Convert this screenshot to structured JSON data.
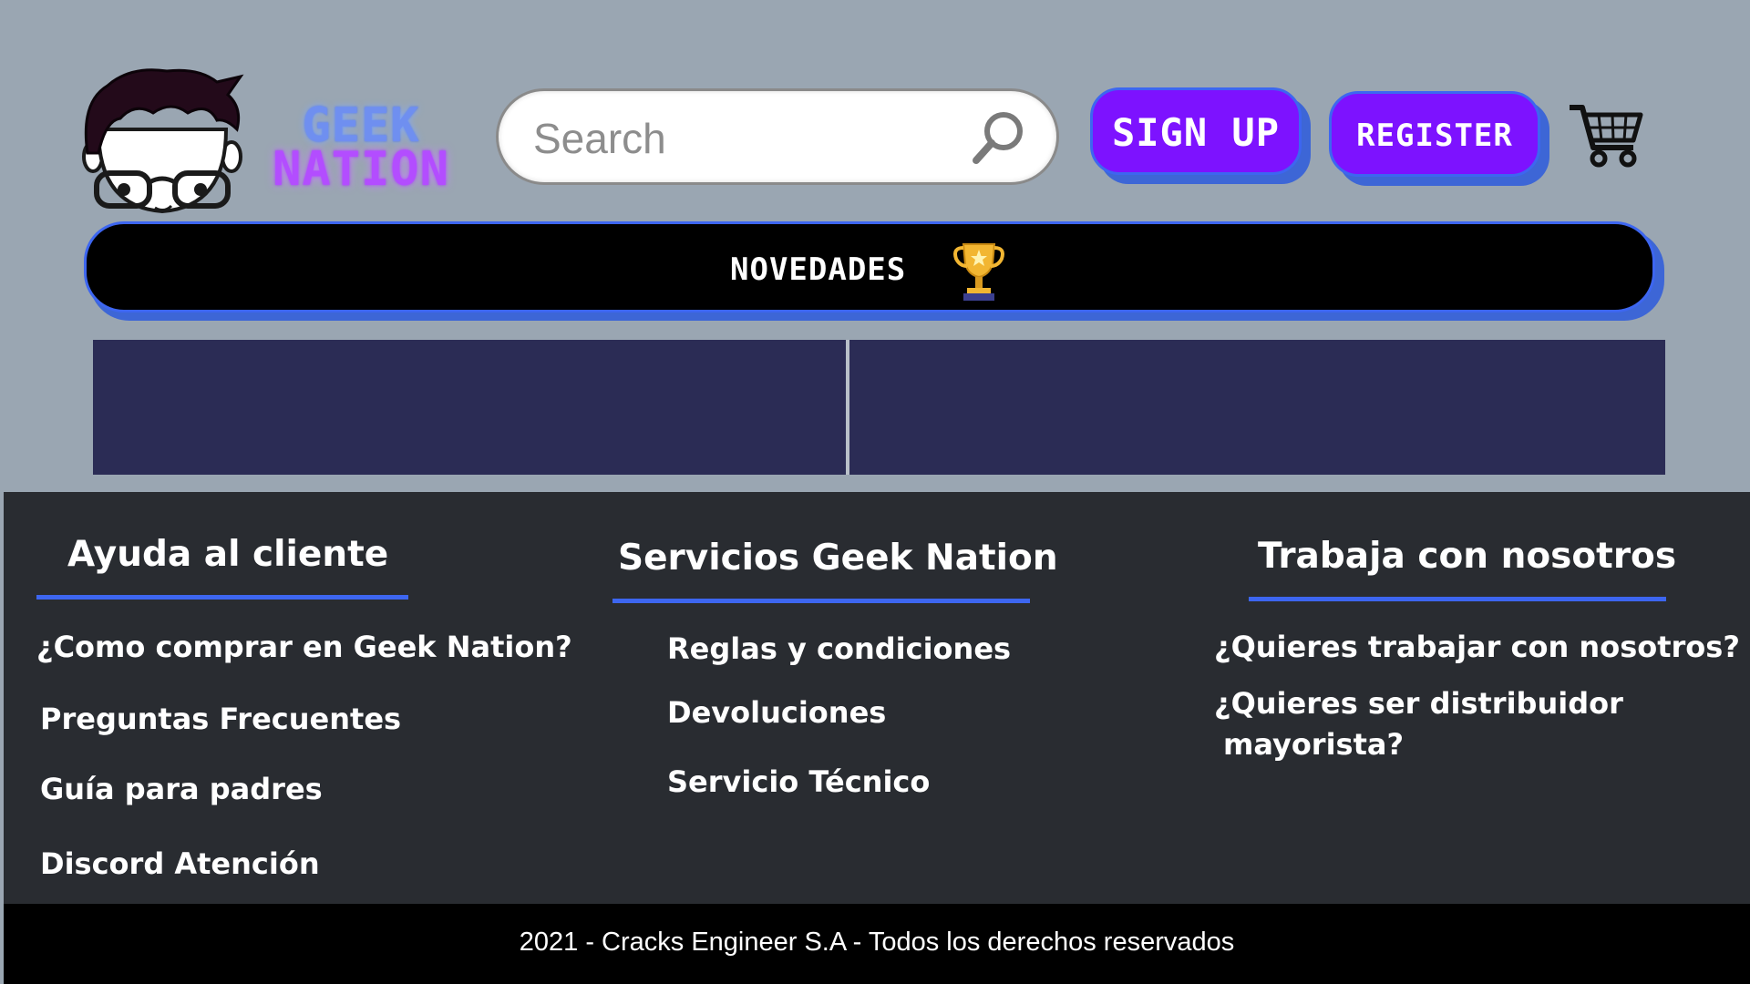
{
  "header": {
    "brand_line1": "GEEK",
    "brand_line2": "NATION",
    "search": {
      "placeholder": "Search"
    },
    "signup_label": "SIGN UP",
    "register_label": "REGISTER"
  },
  "nav": {
    "novedades_label": "NOVEDADES"
  },
  "footer": {
    "columns": [
      {
        "title": "Ayuda al cliente",
        "links": [
          "¿Como comprar en Geek Nation?",
          "Preguntas Frecuentes",
          "Guía para padres",
          "Discord Atención"
        ]
      },
      {
        "title": "Servicios Geek Nation",
        "links": [
          "Reglas y condiciones",
          "Devoluciones",
          "Servicio Técnico"
        ]
      },
      {
        "title": "Trabaja con nosotros",
        "links": [
          "¿Quieres trabajar con nosotros?",
          "¿Quieres ser distribuidor",
          "mayorista?"
        ]
      }
    ],
    "copyright": "2021 - Cracks Engineer S.A - Todos los derechos reservados"
  },
  "colors": {
    "page_bg": "#9aa6b2",
    "accent_blue": "#3d66f0",
    "button_purple": "#7d12ff",
    "banner_navy": "#2b2c55",
    "footer_bg": "#292c31"
  },
  "icons": [
    "geek-mascot-logo",
    "search-icon",
    "shopping-cart-icon",
    "trophy-icon"
  ]
}
